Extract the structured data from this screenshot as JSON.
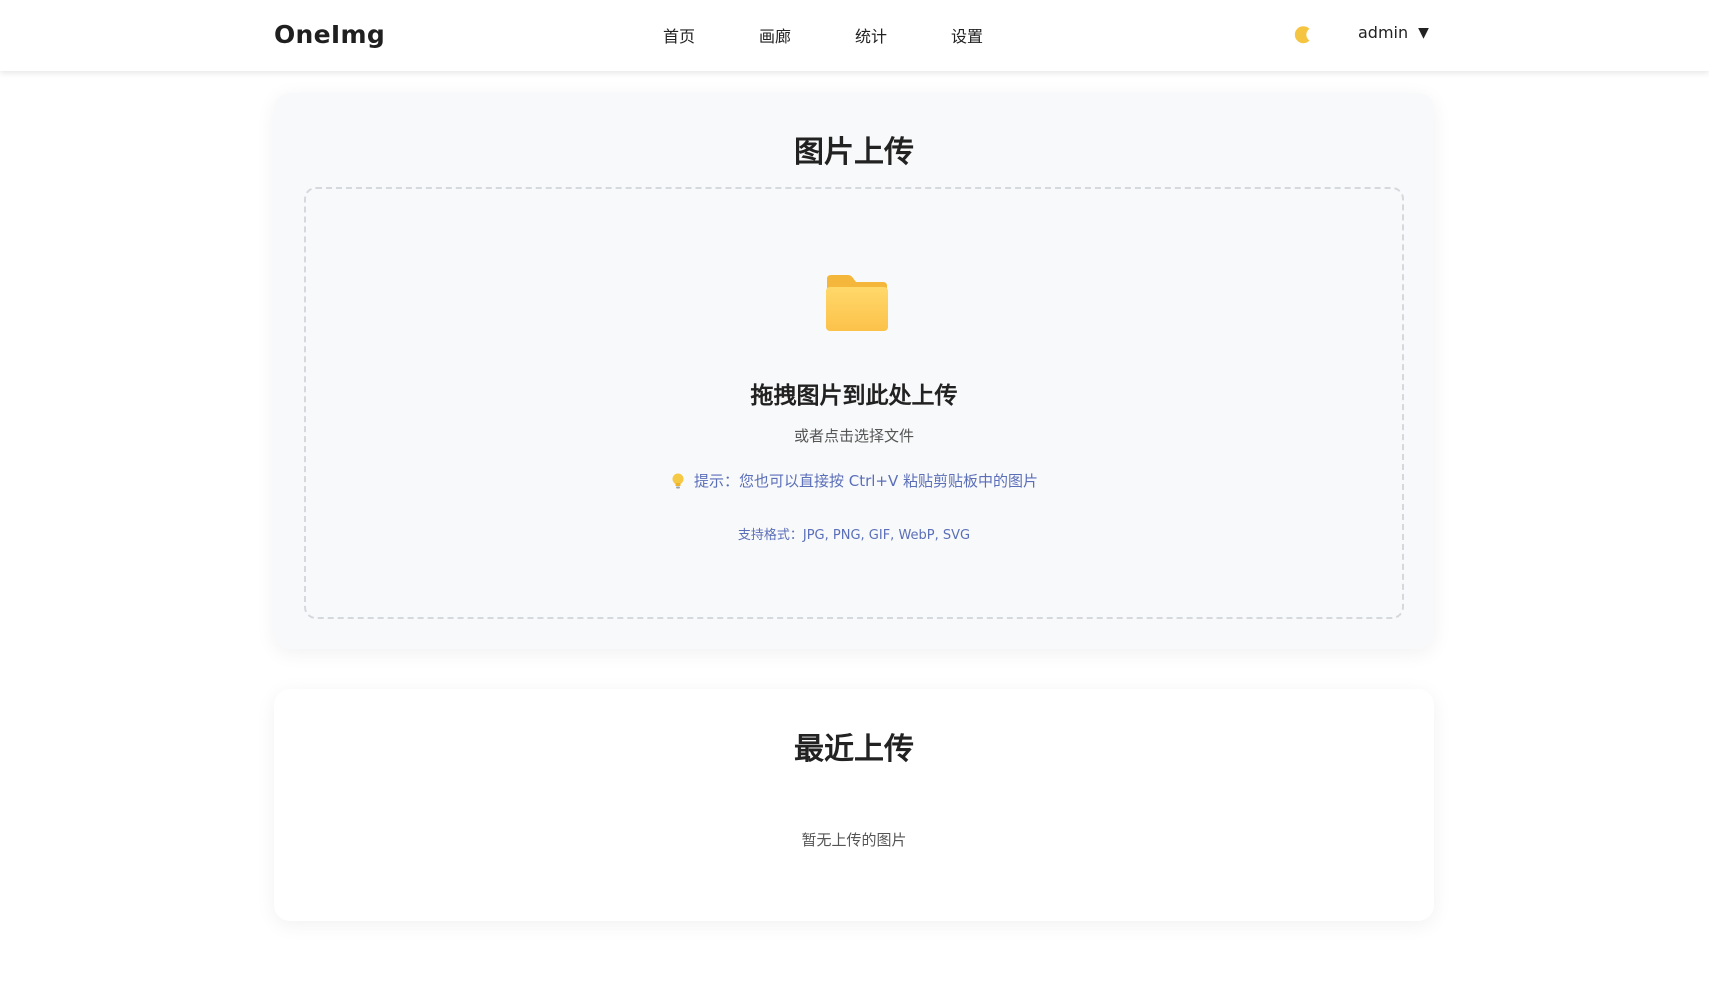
{
  "brand": {
    "name": "OneImg"
  },
  "nav": {
    "items": [
      {
        "label": "首页"
      },
      {
        "label": "画廊"
      },
      {
        "label": "统计"
      },
      {
        "label": "设置"
      }
    ]
  },
  "header": {
    "theme_icon": "moon-icon",
    "user": {
      "name": "admin",
      "caret": "▼"
    }
  },
  "upload": {
    "title": "图片上传",
    "icon": "folder-icon",
    "drop_title": "拖拽图片到此处上传",
    "drop_subtitle": "或者点击选择文件",
    "tip_icon": "lightbulb-icon",
    "tip": "提示：您也可以直接按 Ctrl+V 粘贴剪贴板中的图片",
    "formats": "支持格式：JPG, PNG, GIF, WebP, SVG"
  },
  "recent": {
    "title": "最近上传",
    "empty": "暂无上传的图片"
  },
  "colors": {
    "accent_text": "#5b6fb9",
    "folder": "#fcc94e",
    "card_bg": "#f8f9fa"
  }
}
